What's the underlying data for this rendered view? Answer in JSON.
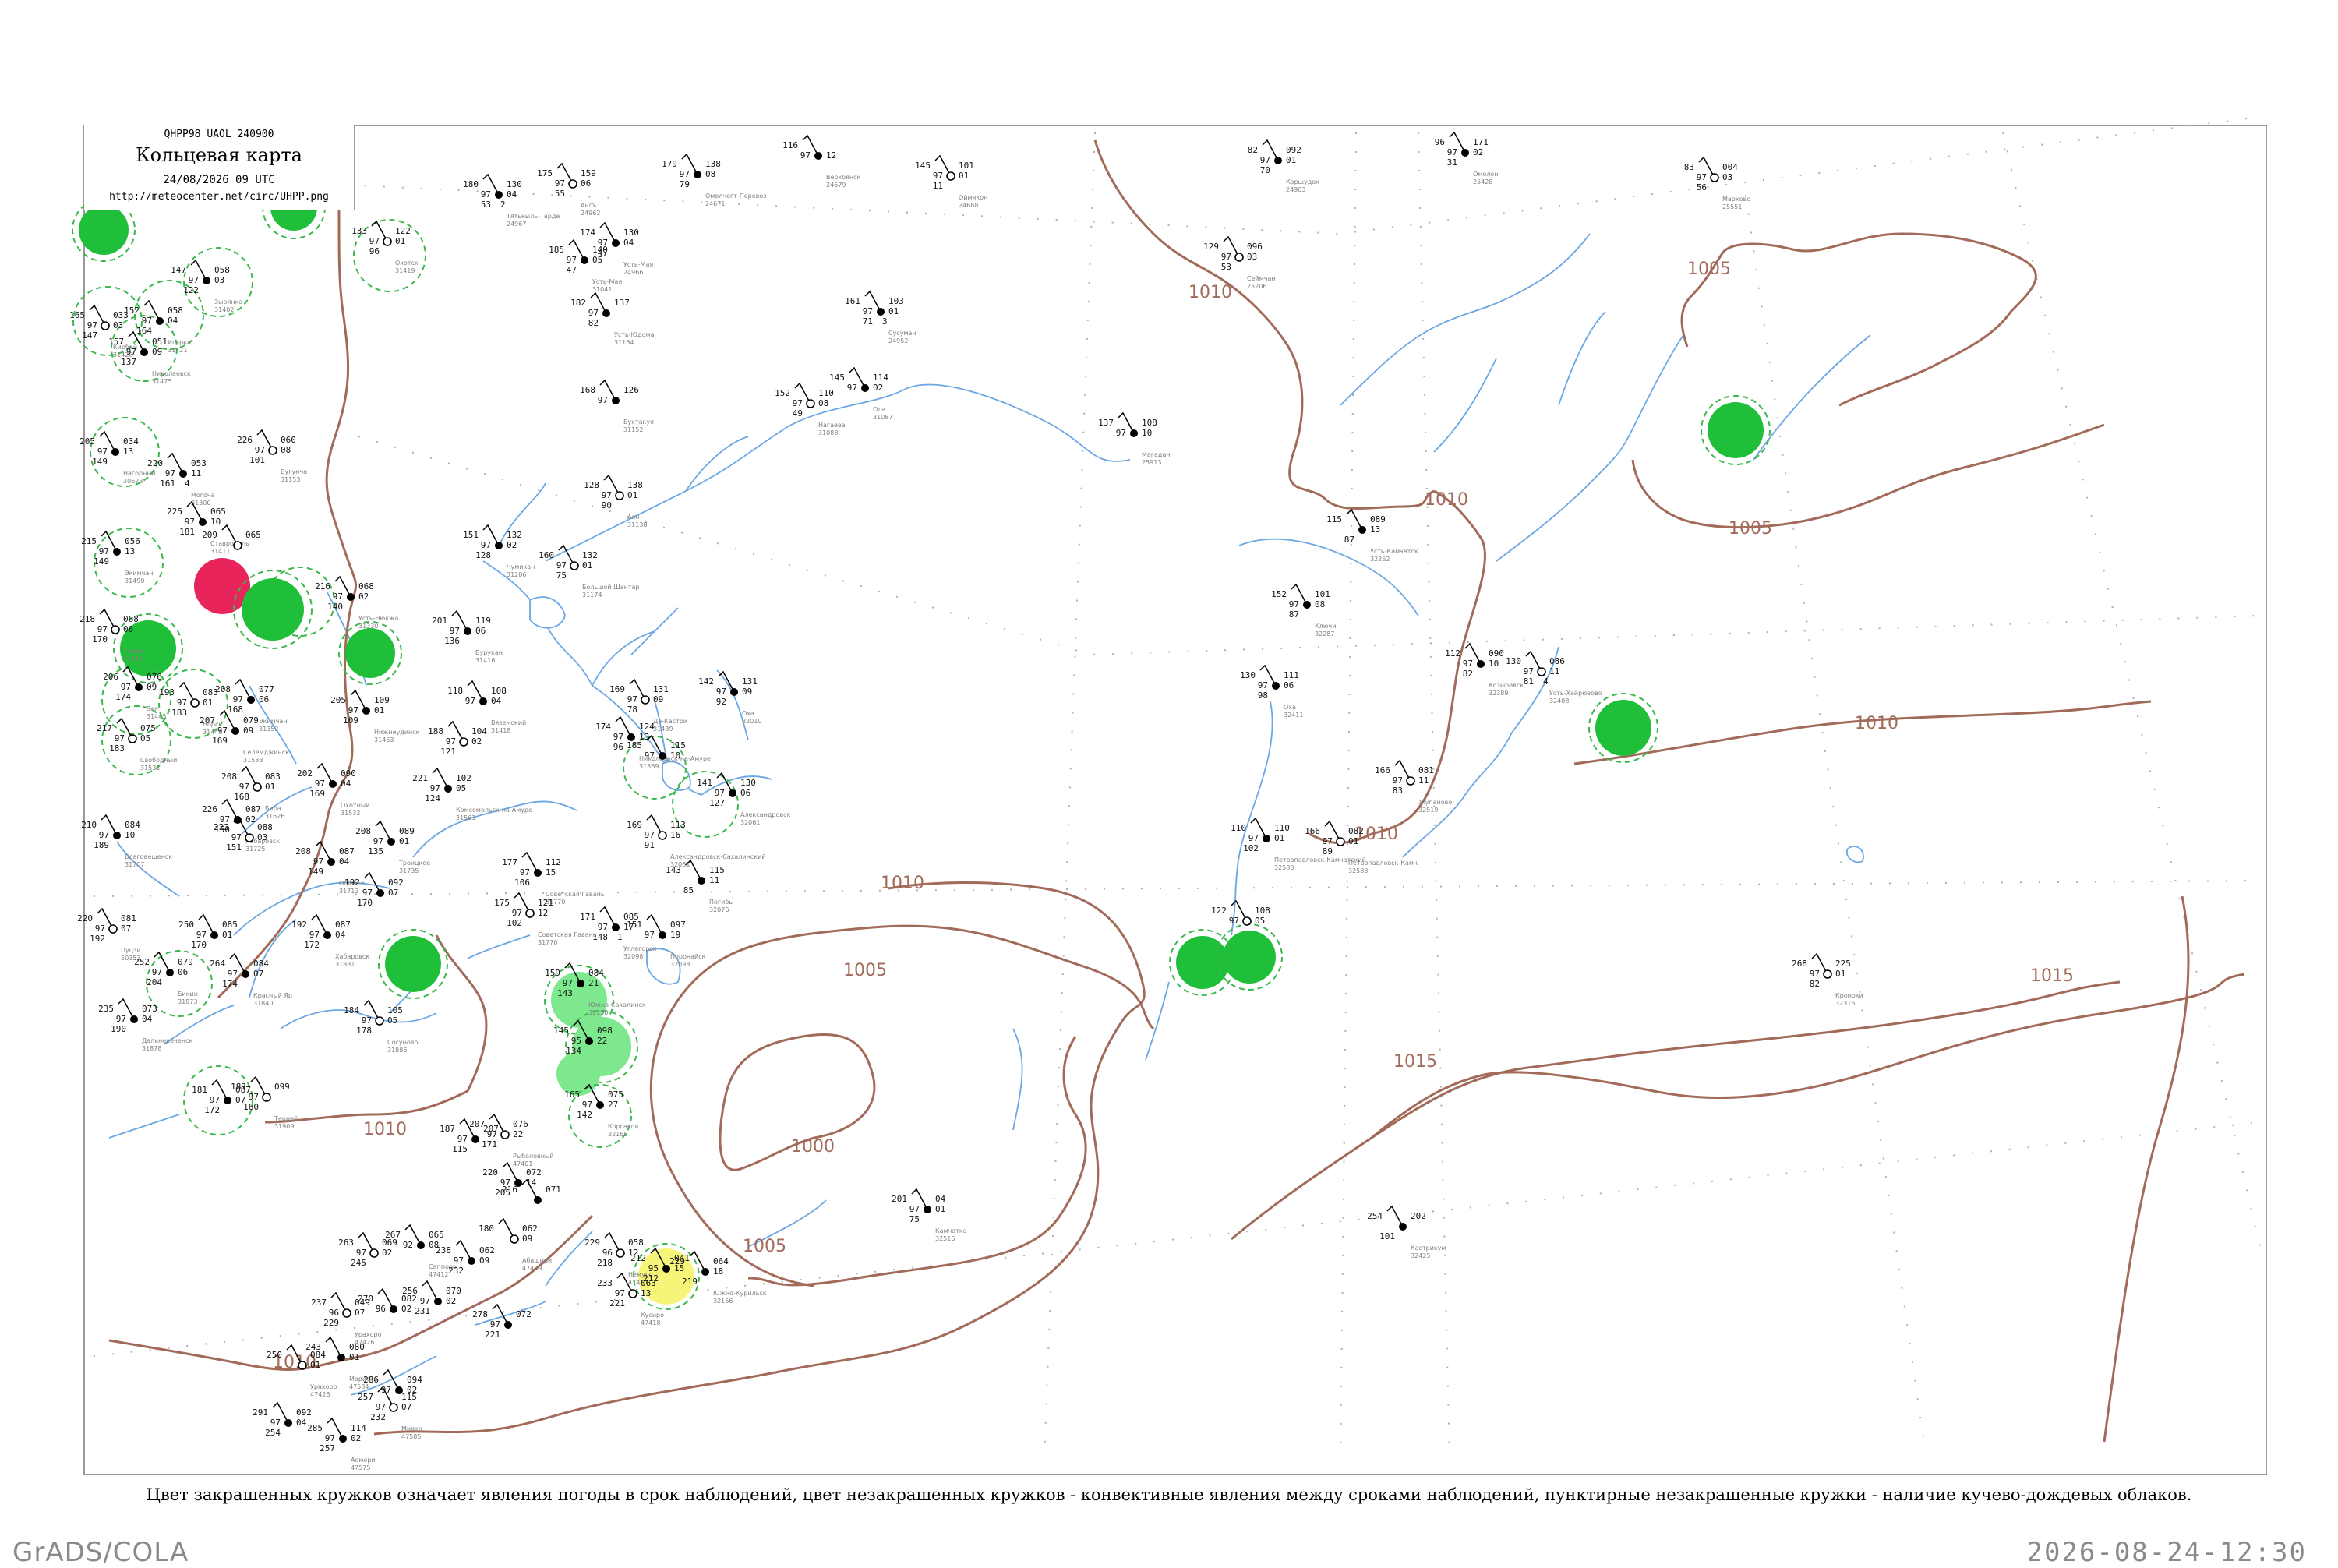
{
  "header": {
    "code_line": "QHPP98  UAOL  240900",
    "title": "Кольцевая карта",
    "datetime": "24/08/2026 09 UTC",
    "url": "http://meteocenter.net/circ/UHPP.png"
  },
  "caption": "Цвет закрашенных кружков означает явления погоды в срок наблюдений, цвет незакрашенных кружков - конвективные явления между сроками наблюдений, пунктирные незакрашенные кружки - наличие кучево-дождевых облаков.",
  "footer": {
    "software": "GrADS/COLA",
    "render_timestamp": "2026-08-24-12:30"
  },
  "colors": {
    "isobar": "#a26a58",
    "river": "#6aa7e3",
    "shower_fill": "#1fbf3a",
    "drizzle_fill": "#7ee88f",
    "thunder_fill": "#e8245a",
    "fog_fill": "#f7f47a",
    "cb_ring": "#3bb84c"
  },
  "isobars": [
    {
      "value": "1000"
    },
    {
      "value": "1005"
    },
    {
      "value": "1010"
    },
    {
      "value": "1015"
    }
  ],
  "isobar_labels": [
    "1000",
    "1005",
    "1005",
    "1005",
    "1005",
    "1010",
    "1010",
    "1010",
    "1010",
    "1010",
    "1010",
    "1015",
    "1015"
  ],
  "stations": [
    {
      "t": "180",
      "p": "130",
      "a": "97",
      "b": "04",
      "c": "53",
      "d": "2",
      "name": "Тятькыль-Тарде",
      "id": "24967"
    },
    {
      "t": "175",
      "p": "159",
      "a": "97",
      "b": "06",
      "c": "55",
      "d": "",
      "name": "Ангъ",
      "id": "24962"
    },
    {
      "t": "179",
      "p": "138",
      "a": "97",
      "b": "08",
      "c": "79",
      "d": "",
      "name": "Омолчегт-Перевоз",
      "id": "24671"
    },
    {
      "t": "116",
      "p": "",
      "a": "97",
      "b": "12",
      "c": "",
      "d": "",
      "name": "Верхоянск",
      "id": "24679"
    },
    {
      "t": "145",
      "p": "101",
      "a": "97",
      "b": "01",
      "c": "11",
      "d": "",
      "name": "Оймякон",
      "id": "24688"
    },
    {
      "t": "82",
      "p": "092",
      "a": "97",
      "b": "01",
      "c": "70",
      "d": "",
      "name": "Коршудок",
      "id": "24903"
    },
    {
      "t": "96",
      "p": "171",
      "a": "97",
      "b": "02",
      "c": "31",
      "d": "",
      "name": "Омолон",
      "id": "25428"
    },
    {
      "t": "83",
      "p": "004",
      "a": "97",
      "b": "03",
      "c": "56",
      "d": "",
      "name": "Марково",
      "id": "25551"
    },
    {
      "t": "185",
      "p": "140",
      "a": "97",
      "b": "05",
      "c": "47",
      "d": "",
      "name": "Усть-Мая",
      "id": "31041"
    },
    {
      "t": "174",
      "p": "130",
      "a": "97",
      "b": "04",
      "c": "47",
      "d": "",
      "name": "Усть-Мая",
      "id": "24966"
    },
    {
      "t": "129",
      "p": "096",
      "a": "97",
      "b": "03",
      "c": "53",
      "d": "",
      "name": "Сеймчан",
      "id": "25206"
    },
    {
      "t": "182",
      "p": "137",
      "a": "97",
      "b": "",
      "c": "82",
      "d": "",
      "name": "Усть-Юдома",
      "id": "31164"
    },
    {
      "t": "161",
      "p": "103",
      "a": "97",
      "b": "01",
      "c": "71",
      "d": "3",
      "name": "Сусуман",
      "id": "24952"
    },
    {
      "t": "133",
      "p": "122",
      "a": "97",
      "b": "01",
      "c": "96",
      "d": "",
      "name": "Охотск",
      "id": "31419"
    },
    {
      "t": "147",
      "p": "058",
      "a": "97",
      "b": "03",
      "c": "122",
      "d": "",
      "name": "Зырянка",
      "id": "31402"
    },
    {
      "t": "152",
      "p": "058",
      "a": "97",
      "b": "04",
      "c": "164",
      "d": "",
      "name": "Игарка",
      "id": "31421"
    },
    {
      "t": "165",
      "p": "033",
      "a": "97",
      "b": "03",
      "c": "147",
      "d": "",
      "name": "Кирбей",
      "id": "31428"
    },
    {
      "t": "157",
      "p": "051",
      "a": "97",
      "b": "09",
      "c": "137",
      "d": "",
      "name": "Николаевск",
      "id": "31475"
    },
    {
      "t": "168",
      "p": "126",
      "a": "97",
      "b": "",
      "c": "",
      "d": "",
      "name": "Бухтакуя",
      "id": "31152"
    },
    {
      "t": "152",
      "p": "110",
      "a": "97",
      "b": "08",
      "c": "49",
      "d": "",
      "name": "Нагаева",
      "id": "31088"
    },
    {
      "t": "145",
      "p": "114",
      "a": "97",
      "b": "02",
      "c": "",
      "d": "",
      "name": "Ола",
      "id": "31087"
    },
    {
      "t": "137",
      "p": "108",
      "a": "97",
      "b": "10",
      "c": "",
      "d": "",
      "name": "Магадан",
      "id": "25913"
    },
    {
      "t": "226",
      "p": "060",
      "a": "97",
      "b": "08",
      "c": "101",
      "d": "",
      "name": "Бугунча",
      "id": "31153"
    },
    {
      "t": "205",
      "p": "034",
      "a": "97",
      "b": "13",
      "c": "149",
      "d": "",
      "name": "Нагорный",
      "id": "30673"
    },
    {
      "t": "220",
      "p": "053",
      "a": "97",
      "b": "11",
      "c": "161",
      "d": "4",
      "name": "Могоча",
      "id": "31300"
    },
    {
      "t": "128",
      "p": "138",
      "a": "97",
      "b": "01",
      "c": "90",
      "d": "",
      "name": "Аян",
      "id": "31138"
    },
    {
      "t": "225",
      "p": "065",
      "a": "97",
      "b": "10",
      "c": "181",
      "d": "",
      "name": "Ставрополь",
      "id": "31411"
    },
    {
      "t": "151",
      "p": "132",
      "a": "97",
      "b": "02",
      "c": "128",
      "d": "",
      "name": "Чумикан",
      "id": "31286"
    },
    {
      "t": "160",
      "p": "132",
      "a": "97",
      "b": "01",
      "c": "75",
      "d": "",
      "name": "Большой Шантар",
      "id": "31174"
    },
    {
      "t": "115",
      "p": "089",
      "a": "",
      "b": "13",
      "c": "87",
      "d": "",
      "name": "Усть-Камчатск",
      "id": "32252"
    },
    {
      "t": "215",
      "p": "056",
      "a": "97",
      "b": "13",
      "c": "149",
      "d": "",
      "name": "Экимчан",
      "id": "31490"
    },
    {
      "t": "209",
      "p": "065",
      "a": "",
      "b": "",
      "c": "",
      "d": "",
      "name": "",
      "id": ""
    },
    {
      "t": "216",
      "p": "068",
      "a": "97",
      "b": "02",
      "c": "140",
      "d": "",
      "name": "Усть-Нюкжа",
      "id": "31330"
    },
    {
      "t": "152",
      "p": "101",
      "a": "97",
      "b": "08",
      "c": "87",
      "d": "",
      "name": "Ключи",
      "id": "32287"
    },
    {
      "t": "218",
      "p": "068",
      "a": "97",
      "b": "06",
      "c": "170",
      "d": "",
      "name": "Тында",
      "id": "31441"
    },
    {
      "t": "201",
      "p": "119",
      "a": "97",
      "b": "06",
      "c": "136",
      "d": "",
      "name": "Бурукан",
      "id": "31416"
    },
    {
      "t": "112",
      "p": "090",
      "a": "97",
      "b": "10",
      "c": "82",
      "d": "",
      "name": "Козыревск",
      "id": "32389"
    },
    {
      "t": "130",
      "p": "086",
      "a": "97",
      "b": "11",
      "c": "81",
      "d": "4",
      "name": "Усть-Хайрюзово",
      "id": "32408"
    },
    {
      "t": "130",
      "p": "111",
      "a": "97",
      "b": "06",
      "c": "98",
      "d": "",
      "name": "Оха",
      "id": "32411"
    },
    {
      "t": "206",
      "p": "076",
      "a": "97",
      "b": "09",
      "c": "174",
      "d": "",
      "name": "Зея",
      "id": "31445"
    },
    {
      "t": "193",
      "p": "083",
      "a": "97",
      "b": "01",
      "c": "183",
      "d": "",
      "name": "Норск",
      "id": "31446"
    },
    {
      "t": "208",
      "p": "077",
      "a": "97",
      "b": "06",
      "c": "168",
      "d": "",
      "name": "Экимчан",
      "id": "31352"
    },
    {
      "t": "118",
      "p": "108",
      "a": "97",
      "b": "04",
      "c": "",
      "d": "",
      "name": "Вяземский",
      "id": "31418"
    },
    {
      "t": "169",
      "p": "131",
      "a": "97",
      "b": "09",
      "c": "78",
      "d": "",
      "name": "Де-Кастри",
      "id": "31439"
    },
    {
      "t": "142",
      "p": "131",
      "a": "97",
      "b": "09",
      "c": "92",
      "d": "",
      "name": "Оха",
      "id": "32010"
    },
    {
      "t": "205",
      "p": "109",
      "a": "97",
      "b": "01",
      "c": "109",
      "d": "",
      "name": "Нижнеудинск",
      "id": "31463"
    },
    {
      "t": "217",
      "p": "075",
      "a": "97",
      "b": "05",
      "c": "183",
      "d": "",
      "name": "Свободный",
      "id": "31531"
    },
    {
      "t": "207",
      "p": "079",
      "a": "97",
      "b": "09",
      "c": "169",
      "d": "",
      "name": "Селемджинск",
      "id": "31538"
    },
    {
      "t": "174",
      "p": "124",
      "a": "97",
      "b": "13",
      "c": "96",
      "d": "",
      "name": "Николаевск-на-Амуре",
      "id": "31369"
    },
    {
      "t": "188",
      "p": "104",
      "a": "97",
      "b": "02",
      "c": "121",
      "d": "",
      "name": "",
      "id": ""
    },
    {
      "t": "185",
      "p": "115",
      "a": "97",
      "b": "10",
      "c": "",
      "d": "",
      "name": "",
      "id": ""
    },
    {
      "t": "141",
      "p": "130",
      "a": "97",
      "b": "06",
      "c": "127",
      "d": "",
      "name": "Александровск",
      "id": "32061"
    },
    {
      "t": "166",
      "p": "081",
      "a": "97",
      "b": "11",
      "c": "83",
      "d": "",
      "name": "Жупаново",
      "id": "32519"
    },
    {
      "t": "202",
      "p": "090",
      "a": "97",
      "b": "04",
      "c": "169",
      "d": "",
      "name": "Охотный",
      "id": "31532"
    },
    {
      "t": "221",
      "p": "102",
      "a": "97",
      "b": "05",
      "c": "124",
      "d": "",
      "name": "Комсомольск-на-Амуре",
      "id": "31561"
    },
    {
      "t": "208",
      "p": "083",
      "a": "97",
      "b": "01",
      "c": "168",
      "d": "",
      "name": "Бира",
      "id": "31626"
    },
    {
      "t": "210",
      "p": "084",
      "a": "97",
      "b": "10",
      "c": "189",
      "d": "",
      "name": "Благовещенск",
      "id": "31707"
    },
    {
      "t": "226",
      "p": "087",
      "a": "97",
      "b": "02",
      "c": "150",
      "d": "",
      "name": "Хабаровск",
      "id": "31725"
    },
    {
      "t": "222",
      "p": "088",
      "a": "97",
      "b": "03",
      "c": "151",
      "d": "",
      "name": "",
      "id": ""
    },
    {
      "t": "208",
      "p": "089",
      "a": "97",
      "b": "01",
      "c": "135",
      "d": "",
      "name": "Троицкое",
      "id": "31735"
    },
    {
      "t": "177",
      "p": "112",
      "a": "97",
      "b": "15",
      "c": "106",
      "d": "",
      "name": "Советская Гавань",
      "id": "31770"
    },
    {
      "t": "169",
      "p": "113",
      "a": "97",
      "b": "16",
      "c": "91",
      "d": "",
      "name": "Александровск-Сахалинский",
      "id": "32061"
    },
    {
      "t": "143",
      "p": "115",
      "a": "",
      "b": "11",
      "c": "85",
      "d": "",
      "name": "Погибы",
      "id": "32076"
    },
    {
      "t": "110",
      "p": "110",
      "a": "97",
      "b": "01",
      "c": "102",
      "d": "",
      "name": "Петропавловск-Камчатский",
      "id": "32583"
    },
    {
      "t": "166",
      "p": "082",
      "a": "97",
      "b": "01",
      "c": "89",
      "d": "",
      "name": "Петропавловск-Камч.",
      "id": "32583"
    },
    {
      "t": "208",
      "p": "087",
      "a": "97",
      "b": "04",
      "c": "149",
      "d": "",
      "name": "Обluчье",
      "id": "31713"
    },
    {
      "t": "192",
      "p": "092",
      "a": "97",
      "b": "07",
      "c": "170",
      "d": "",
      "name": "",
      "id": ""
    },
    {
      "t": "175",
      "p": "121",
      "a": "97",
      "b": "12",
      "c": "102",
      "d": "",
      "name": "Советская Гавань",
      "id": "31770"
    },
    {
      "t": "171",
      "p": "085",
      "a": "97",
      "b": "17",
      "c": "148",
      "d": "1",
      "name": "Углегорск",
      "id": "32098"
    },
    {
      "t": "151",
      "p": "097",
      "a": "97",
      "b": "19",
      "c": "",
      "d": "",
      "name": "Поронайск",
      "id": "32098"
    },
    {
      "t": "220",
      "p": "081",
      "a": "97",
      "b": "07",
      "c": "192",
      "d": "",
      "name": "Пуцзи",
      "id": "50353"
    },
    {
      "t": "250",
      "p": "085",
      "a": "97",
      "b": "01",
      "c": "170",
      "d": "",
      "name": "",
      "id": ""
    },
    {
      "t": "192",
      "p": "087",
      "a": "97",
      "b": "04",
      "c": "172",
      "d": "",
      "name": "Хабаровск",
      "id": "31881"
    },
    {
      "t": "122",
      "p": "108",
      "a": "97",
      "b": "05",
      "c": "",
      "d": "",
      "name": "",
      "id": ""
    },
    {
      "t": "252",
      "p": "079",
      "a": "97",
      "b": "06",
      "c": "204",
      "d": "",
      "name": "Бикин",
      "id": "31873"
    },
    {
      "t": "264",
      "p": "084",
      "a": "97",
      "b": "07",
      "c": "174",
      "d": "",
      "name": "Красный Яр",
      "id": "31840"
    },
    {
      "t": "268",
      "p": "225",
      "a": "97",
      "b": "01",
      "c": "82",
      "d": "",
      "name": "Кроноки",
      "id": "32315"
    },
    {
      "t": "159",
      "p": "084",
      "a": "97",
      "b": "21",
      "c": "143",
      "d": "",
      "name": "Южно-Сахалинск",
      "id": "32150"
    },
    {
      "t": "235",
      "p": "073",
      "a": "97",
      "b": "04",
      "c": "190",
      "d": "",
      "name": "Дальнереченск",
      "id": "31878"
    },
    {
      "t": "184",
      "p": "105",
      "a": "97",
      "b": "05",
      "c": "178",
      "d": "",
      "name": "Сосуново",
      "id": "31886"
    },
    {
      "t": "145",
      "p": "098",
      "a": "95",
      "b": "22",
      "c": "134",
      "d": "",
      "name": "",
      "id": ""
    },
    {
      "t": "181",
      "p": "087",
      "a": "97",
      "b": "07",
      "c": "172",
      "d": "",
      "name": "",
      "id": ""
    },
    {
      "t": "187",
      "p": "099",
      "a": "97",
      "b": "",
      "c": "160",
      "d": "",
      "name": "Терней",
      "id": "31909"
    },
    {
      "t": "165",
      "p": "075",
      "a": "97",
      "b": "27",
      "c": "142",
      "d": "",
      "name": "Корсаков",
      "id": "32165"
    },
    {
      "t": "187",
      "p": "207",
      "a": "97",
      "b": "",
      "c": "115",
      "d": "",
      "name": "",
      "id": ""
    },
    {
      "t": "207",
      "p": "076",
      "a": "97",
      "b": "22",
      "c": "171",
      "d": "",
      "name": "Рыболовный",
      "id": "47401"
    },
    {
      "t": "220",
      "p": "072",
      "a": "97",
      "b": "14",
      "c": "205",
      "d": "",
      "name": "",
      "id": ""
    },
    {
      "t": "216",
      "p": "071",
      "a": "",
      "b": "",
      "c": "",
      "d": "",
      "name": "",
      "id": ""
    },
    {
      "t": "180",
      "p": "062",
      "a": "",
      "b": "09",
      "c": "",
      "d": "",
      "name": "Абашири",
      "id": "47409"
    },
    {
      "t": "201",
      "p": "04",
      "a": "97",
      "b": "01",
      "c": "75",
      "d": "",
      "name": "Камчатка",
      "id": "32516"
    },
    {
      "t": "254",
      "p": "202",
      "a": "",
      "b": "",
      "c": "101",
      "d": "",
      "name": "Кастрикум",
      "id": "32425"
    },
    {
      "t": "263",
      "p": "069",
      "a": "97",
      "b": "02",
      "c": "245",
      "d": "",
      "name": "",
      "id": ""
    },
    {
      "t": "267",
      "p": "065",
      "a": "92",
      "b": "08",
      "c": "",
      "d": "",
      "name": "Саппоро",
      "id": "47412"
    },
    {
      "t": "238",
      "p": "062",
      "a": "97",
      "b": "09",
      "c": "232",
      "d": "",
      "name": "",
      "id": ""
    },
    {
      "t": "229",
      "p": "058",
      "a": "96",
      "b": "12",
      "c": "218",
      "d": "",
      "name": "Немуро",
      "id": "47420"
    },
    {
      "t": "212",
      "p": "041",
      "a": "95",
      "b": "15",
      "c": "212",
      "d": "",
      "name": "",
      "id": ""
    },
    {
      "t": "229",
      "p": "064",
      "a": "",
      "b": "18",
      "c": "219",
      "d": "",
      "name": "Южно-Курильск",
      "id": "32166"
    },
    {
      "t": "233",
      "p": "063",
      "a": "97",
      "b": "13",
      "c": "221",
      "d": "",
      "name": "Кусиро",
      "id": "47418"
    },
    {
      "t": "256",
      "p": "070",
      "a": "97",
      "b": "02",
      "c": "231",
      "d": "",
      "name": "",
      "id": ""
    },
    {
      "t": "278",
      "p": "072",
      "a": "97",
      "b": "",
      "c": "221",
      "d": "",
      "name": "",
      "id": ""
    },
    {
      "t": "237",
      "p": "049",
      "a": "96",
      "b": "07",
      "c": "229",
      "d": "",
      "name": "Урахоро",
      "id": "47426"
    },
    {
      "t": "270",
      "p": "082",
      "a": "96",
      "b": "02",
      "c": "",
      "d": "",
      "name": "",
      "id": ""
    },
    {
      "t": "243",
      "p": "080",
      "a": "",
      "b": "01",
      "c": "",
      "d": "",
      "name": "Мориока",
      "id": "47584"
    },
    {
      "t": "250",
      "p": "084",
      "a": "",
      "b": "01",
      "c": "",
      "d": "",
      "name": "Урахоро",
      "id": "47426"
    },
    {
      "t": "291",
      "p": "092",
      "a": "97",
      "b": "04",
      "c": "254",
      "d": "",
      "name": "",
      "id": ""
    },
    {
      "t": "285",
      "p": "114",
      "a": "97",
      "b": "02",
      "c": "257",
      "d": "",
      "name": "Аомори",
      "id": "47575"
    },
    {
      "t": "257",
      "p": "115",
      "a": "97",
      "b": "07",
      "c": "232",
      "d": "",
      "name": "Мияко",
      "id": "47585"
    },
    {
      "t": "286",
      "p": "094",
      "a": "97",
      "b": "02",
      "c": "",
      "d": "",
      "name": "",
      "id": ""
    }
  ]
}
